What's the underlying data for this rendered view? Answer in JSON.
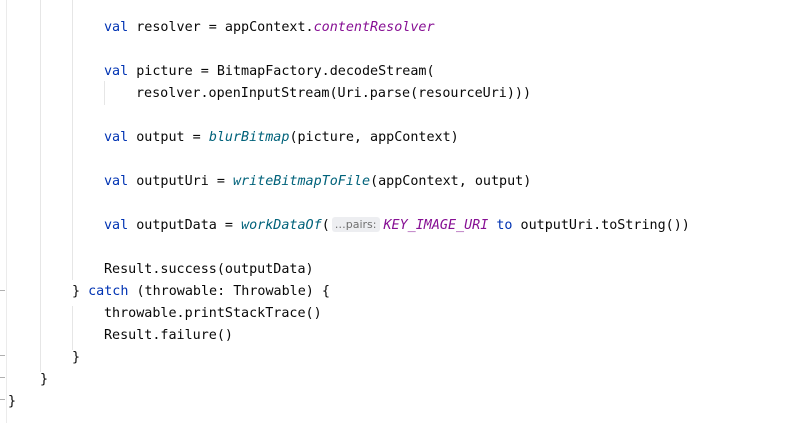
{
  "editor": {
    "lines": {
      "resolver": {
        "kw": "val",
        "name": " resolver = appContext.",
        "prop": "contentResolver"
      },
      "picture": {
        "kw": "val",
        "rest": " picture = BitmapFactory.decodeStream("
      },
      "open_stream": {
        "text": "resolver.openInputStream(Uri.parse(resourceUri)))"
      },
      "output": {
        "kw": "val",
        "name": " output = ",
        "fn": "blurBitmap",
        "rest": "(picture, appContext)"
      },
      "output_uri": {
        "kw": "val",
        "name": " outputUri = ",
        "fn": "writeBitmapToFile",
        "rest": "(appContext, output)"
      },
      "output_data": {
        "kw": "val",
        "name": " outputData = ",
        "fn": "workDataOf",
        "paren": "(",
        "hint": "…pairs:",
        "const": "KEY_IMAGE_URI",
        "to_kw": "to",
        "rest": " outputUri.toString())"
      },
      "result_success": {
        "text": "Result.success(outputData)"
      },
      "catch": {
        "brace": "} ",
        "kw": "catch",
        "rest": " (throwable: Throwable) {"
      },
      "print_stack": {
        "text": "throwable.printStackTrace()"
      },
      "result_failure": {
        "text": "Result.failure()"
      },
      "close_catch": {
        "text": "}"
      },
      "close_try": {
        "text": "}"
      },
      "close_class": {
        "text": "}"
      }
    }
  }
}
